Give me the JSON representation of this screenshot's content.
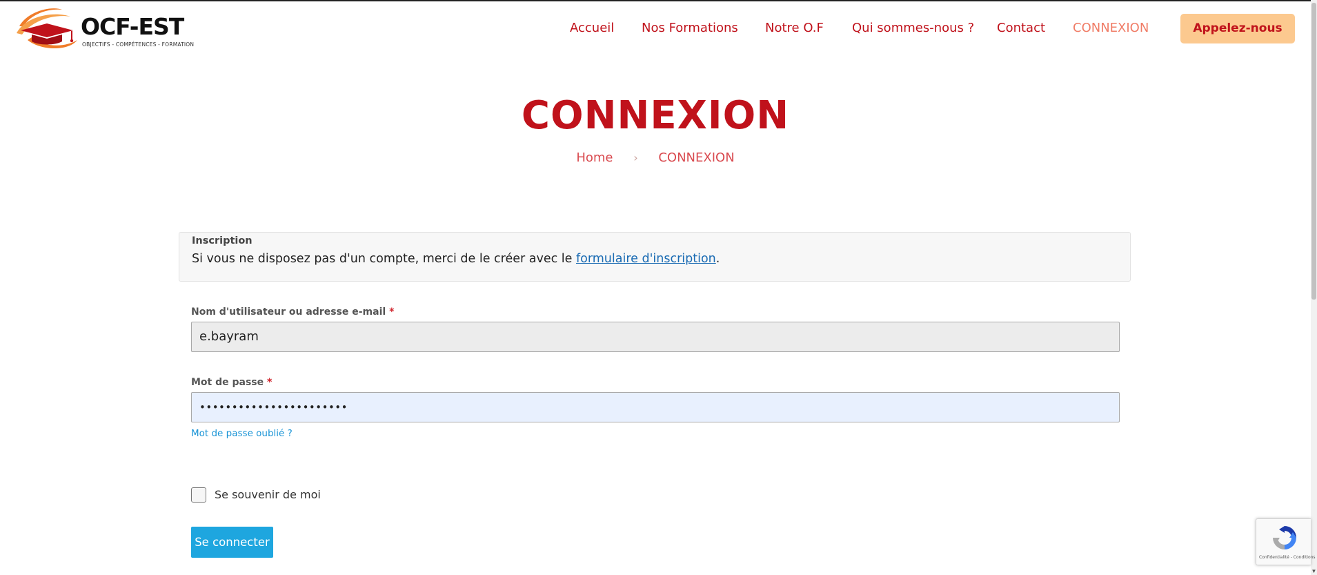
{
  "brand": {
    "name": "OCF-EST",
    "tagline": "OBJECTIFS - COMPÉTENCES - FORMATION",
    "primary_color": "#c0121b",
    "accent_color": "#f07c66",
    "call_button_color": "#fcc98f",
    "link_color": "#1ea6df"
  },
  "nav": {
    "items": [
      {
        "label": "Accueil",
        "active": false
      },
      {
        "label": "Nos Formations",
        "active": false
      },
      {
        "label": "Notre O.F",
        "active": false
      },
      {
        "label": "Qui sommes-nous ?",
        "active": false
      },
      {
        "label": "Contact",
        "active": false
      },
      {
        "label": "CONNEXION",
        "active": true
      }
    ],
    "call_button": "Appelez-nous"
  },
  "page": {
    "title": "CONNEXION",
    "breadcrumb": {
      "home": "Home",
      "separator_icon": "chevron-right-icon",
      "current": "CONNEXION"
    }
  },
  "notice": {
    "title": "Inscription",
    "text_before": "Si vous ne disposez pas d'un compte, merci de le créer avec le ",
    "link": "formulaire d'inscription",
    "text_after": "."
  },
  "form": {
    "username": {
      "label": "Nom d'utilisateur ou adresse e-mail",
      "required_mark": "*",
      "value": "e.bayram"
    },
    "password": {
      "label": "Mot de passe",
      "required_mark": "*",
      "value": "•••••••••••••••••••••••"
    },
    "forgot_link": "Mot de passe oublié ?",
    "remember": {
      "label": "Se souvenir de moi",
      "checked": false
    },
    "submit": "Se connecter"
  },
  "recaptcha": {
    "icon": "recaptcha-icon",
    "footer": "Confidentialité - Conditions"
  }
}
